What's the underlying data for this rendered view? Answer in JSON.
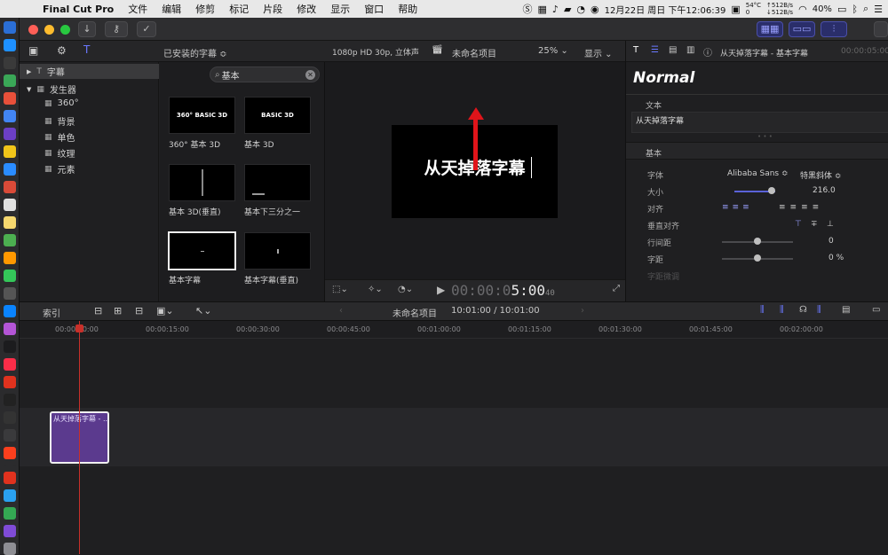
{
  "menubar": {
    "apple": "",
    "items": [
      "Final Cut Pro",
      "文件",
      "编辑",
      "修剪",
      "标记",
      "片段",
      "修改",
      "显示",
      "窗口",
      "帮助"
    ],
    "temp": "54°C",
    "temp_sub": "0",
    "net_up": "↑512B/s",
    "net_down": "↓512B/s",
    "datetime": "12月22日 周日 下午12:06:39",
    "battery": "40%"
  },
  "browser": {
    "library_filter": "已安装的字幕 ≎",
    "search_value": "基本",
    "sidebar": [
      {
        "label": "字幕",
        "glyph": "T",
        "expander": "▶"
      },
      {
        "label": "发生器",
        "glyph": "▦",
        "expander": "▼"
      },
      {
        "label": "360°",
        "glyph": "▦",
        "expander": ""
      },
      {
        "label": "背景",
        "glyph": "▦",
        "expander": ""
      },
      {
        "label": "单色",
        "glyph": "▦",
        "expander": ""
      },
      {
        "label": "纹理",
        "glyph": "▦",
        "expander": ""
      },
      {
        "label": "元素",
        "glyph": "▦",
        "expander": ""
      }
    ],
    "thumbs": [
      {
        "caption": "360° 基本 3D",
        "preview": "360° BASIC 3D"
      },
      {
        "caption": "基本 3D",
        "preview": "BASIC 3D"
      },
      {
        "caption": "基本 3D(垂直)",
        "preview": ""
      },
      {
        "caption": "基本下三分之一",
        "preview": ""
      },
      {
        "caption": "基本字幕",
        "preview": ""
      },
      {
        "caption": "基本字幕(垂直)",
        "preview": ""
      }
    ]
  },
  "viewer": {
    "format": "1080p HD 30p, 立体声",
    "project": "未命名项目",
    "zoom": "25% ⌄",
    "display": "显示 ⌄",
    "title_text": "从天掉落字幕",
    "timecode_dim": "00:00:0",
    "timecode_bright": "5:00",
    "timecode_frames": "40"
  },
  "inspector": {
    "header_title": "从天掉落字幕 - 基本字幕",
    "header_time": "00:00:05:00",
    "style": "Normal",
    "text_section": "文本",
    "text_value": "从天掉落字幕",
    "basic_section": "基本",
    "rows": [
      {
        "label": "字体",
        "value": "Alibaba Sans ≎",
        "value2": "特黑斜体 ≎"
      },
      {
        "label": "大小",
        "value": "216.0",
        "value2": ""
      },
      {
        "label": "对齐",
        "value": "",
        "value2": ""
      },
      {
        "label": "垂直对齐",
        "value": "",
        "value2": ""
      },
      {
        "label": "行间距",
        "value": "0",
        "value2": ""
      },
      {
        "label": "字距",
        "value": "0 %",
        "value2": ""
      },
      {
        "label": "字距微调",
        "value": "",
        "value2": ""
      }
    ]
  },
  "timeline": {
    "index_label": "索引",
    "project": "未命名项目",
    "duration": "10:01:00 / 10:01:00",
    "ruler": [
      "00:00:00:00",
      "00:00:15:00",
      "00:00:30:00",
      "00:00:45:00",
      "00:01:00:00",
      "00:01:15:00",
      "00:01:30:00",
      "00:01:45:00",
      "00:02:00:00"
    ],
    "clip_label": "从天掉落字幕 - ..."
  },
  "colors": {
    "accent": "#5b3a8e",
    "arrow": "#e0141a",
    "playhead": "#c8302a",
    "highlight": "#4a4fa8"
  }
}
